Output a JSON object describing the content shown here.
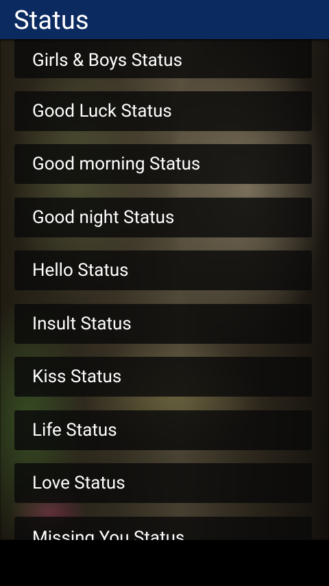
{
  "app_bar": {
    "title": "Status",
    "background_color": "#0b2a60"
  },
  "list": {
    "items": [
      {
        "label": "Girls & Boys Status"
      },
      {
        "label": "Good Luck Status"
      },
      {
        "label": "Good morning Status"
      },
      {
        "label": "Good night Status"
      },
      {
        "label": "Hello Status"
      },
      {
        "label": "Insult Status"
      },
      {
        "label": "Kiss Status"
      },
      {
        "label": "Life Status"
      },
      {
        "label": "Love Status"
      },
      {
        "label": "Missing You Status"
      }
    ]
  }
}
